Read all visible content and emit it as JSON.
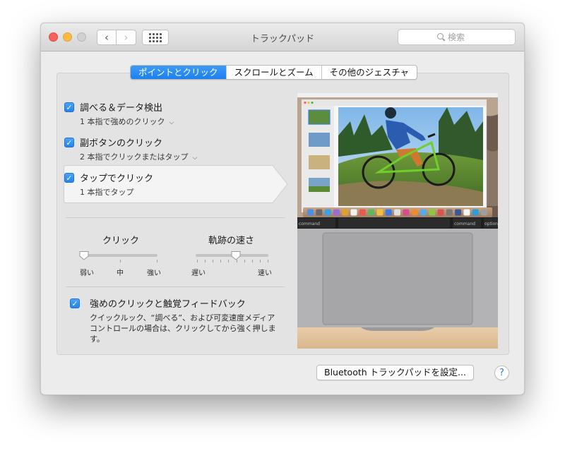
{
  "window": {
    "title": "トラックパッド"
  },
  "toolbar": {
    "back_glyph": "‹",
    "forward_glyph": "›"
  },
  "search": {
    "placeholder": "検索"
  },
  "tabs": [
    {
      "label": "ポイントとクリック",
      "active": true
    },
    {
      "label": "スクロールとズーム",
      "active": false
    },
    {
      "label": "その他のジェスチャ",
      "active": false
    }
  ],
  "options": [
    {
      "title": "調べる＆データ検出",
      "subtitle": "1 本指で強めのクリック",
      "checked": true,
      "has_dropdown": true
    },
    {
      "title": "副ボタンのクリック",
      "subtitle": "2 本指でクリックまたはタップ",
      "checked": true,
      "has_dropdown": true
    },
    {
      "title": "タップでクリック",
      "subtitle": "1 本指でタップ",
      "checked": true,
      "has_dropdown": false,
      "selected": true
    }
  ],
  "click_slider": {
    "label": "クリック",
    "min_label": "弱い",
    "mid_label": "中",
    "max_label": "強い",
    "level": 0
  },
  "speed_slider": {
    "label": "軌跡の速さ",
    "min_label": "遅い",
    "max_label": "速い",
    "level": 0.55
  },
  "force_click": {
    "title": "強めのクリックと触覚フィードバック",
    "description": "クイックルック、“調べる”、および可変速度メディアコントロールの場合は、クリックしてから強く押します。",
    "checked": true
  },
  "preview": {
    "keys": {
      "left_command": "command",
      "right_command": "command",
      "option": "option"
    }
  },
  "bluetooth_button": "Bluetooth トラックパッドを設定...",
  "help_button": "?",
  "colors": {
    "accent": "#1a7ff0",
    "close": "#fc605c",
    "minimize": "#fdbc40"
  }
}
